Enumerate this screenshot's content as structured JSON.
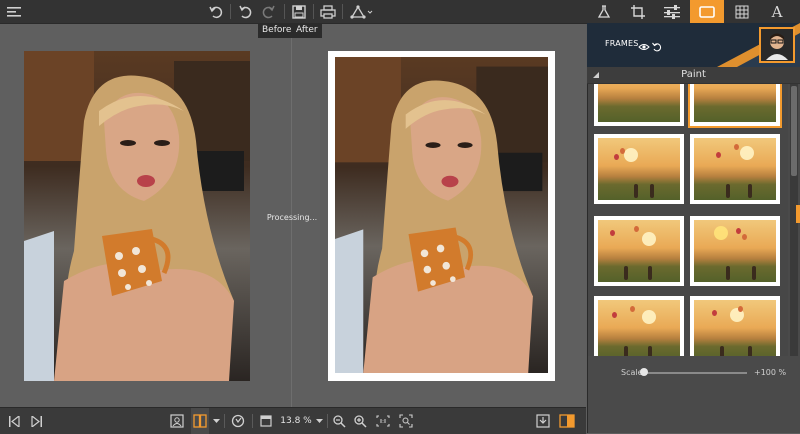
{
  "toolbar": {
    "icons": [
      "menu-icon",
      "undo-icon",
      "undo-step-icon",
      "redo-icon",
      "save-icon",
      "print-icon",
      "share-icon"
    ]
  },
  "right_tabs": {
    "items": [
      "flask-icon",
      "crop-icon",
      "sliders-icon",
      "frame-icon",
      "texture-icon",
      "text-icon"
    ],
    "text_tab_label": "A",
    "active": "frame-icon"
  },
  "compare": {
    "before_label": "Before",
    "after_label": "After",
    "processing_text": "Processing..."
  },
  "bottom": {
    "zoom_text": "13.8 %"
  },
  "panel": {
    "frames_title": "FRAMES",
    "category": "Paint",
    "scale_label": "Scale",
    "scale_value": "+100 %",
    "scale_fraction": 0.0
  },
  "colors": {
    "accent": "#f39a2e",
    "toolbar_bg": "#333333",
    "canvas_bg": "#5f5f5f",
    "panel_bg": "#4a4a4a"
  }
}
